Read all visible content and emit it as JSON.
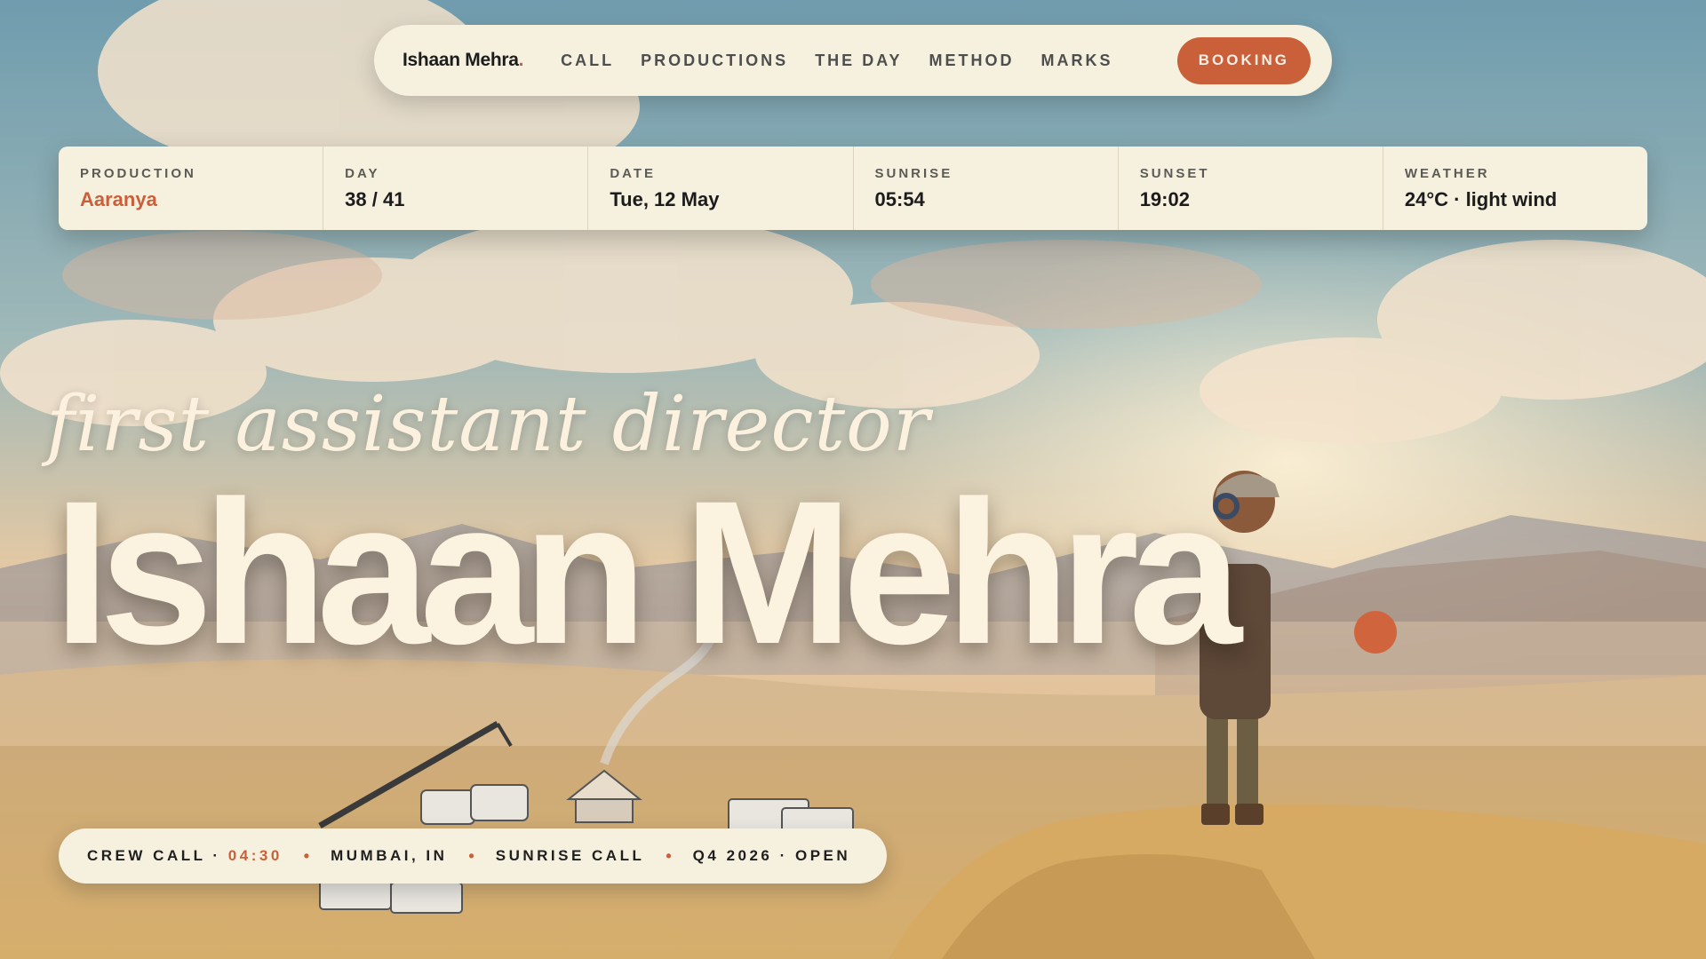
{
  "nav": {
    "brand": "Ishaan Mehra",
    "brand_dot": ".",
    "links": [
      "CALL",
      "PRODUCTIONS",
      "THE DAY",
      "METHOD",
      "MARKS"
    ],
    "cta": "BOOKING"
  },
  "info": [
    {
      "label": "PRODUCTION",
      "value": "Aaranya"
    },
    {
      "label": "DAY",
      "value": "38 / 41"
    },
    {
      "label": "DATE",
      "value": "Tue, 12 May"
    },
    {
      "label": "SUNRISE",
      "value": "05:54"
    },
    {
      "label": "SUNSET",
      "value": "19:02"
    },
    {
      "label": "WEATHER",
      "value": "24°C · light wind"
    }
  ],
  "hero": {
    "subtitle": "first assistant director",
    "name": "Ishaan Mehra"
  },
  "footer": {
    "crew_call_label": "CREW CALL ·",
    "crew_call_time": "04:30",
    "location": "MUMBAI, IN",
    "call_type": "SUNRISE CALL",
    "availability": "Q4 2026 · OPEN",
    "separator": "•"
  },
  "colors": {
    "accent": "#c9603a",
    "panel": "#f6f0df",
    "hero_text": "#fbf3e0"
  }
}
